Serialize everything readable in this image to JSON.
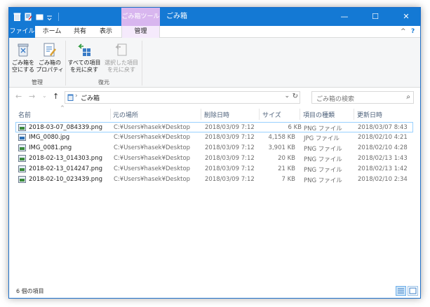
{
  "window": {
    "title": "ごみ箱",
    "context_tab_header": "ごみ箱ツール",
    "controls": {
      "minimize": "—",
      "maximize": "☐",
      "close": "✕"
    }
  },
  "ribbon_tabs": [
    {
      "label": "ファイル"
    },
    {
      "label": "ホーム"
    },
    {
      "label": "共有"
    },
    {
      "label": "表示"
    },
    {
      "label": "管理"
    }
  ],
  "ribbon_controls": {
    "collapse": "^",
    "help": "?"
  },
  "ribbon": {
    "empty_bin": "ごみ箱を\n空にする",
    "properties": "ごみ箱の\nプロパティ",
    "restore_all": "すべての項目\nを元に戻す",
    "restore_selected": "選択した項目\nを元に戻す",
    "group_manage": "管理",
    "group_restore": "復元"
  },
  "navigation": {
    "back": "←",
    "forward": "→",
    "recent": "⌄",
    "up": "↑",
    "path": "ごみ箱",
    "chevron": "›",
    "dropdown": "⌄",
    "refresh": "↻"
  },
  "search": {
    "placeholder": "ごみ箱の検索",
    "icon": "⌕"
  },
  "columns": {
    "name": "名前",
    "original_location": "元の場所",
    "date_deleted": "削除日時",
    "size": "サイズ",
    "type": "項目の種類",
    "date_modified": "更新日時"
  },
  "files": [
    {
      "name": "2018-03-07_084339.png",
      "location": "C:¥Users¥hasek¥Desktop",
      "deleted": "2018/03/09 7:12",
      "size": "6 KB",
      "type": "PNG ファイル",
      "modified": "2018/03/07 8:43",
      "kind": "png"
    },
    {
      "name": "IMG_0080.jpg",
      "location": "C:¥Users¥hasek¥Desktop",
      "deleted": "2018/03/09 7:12",
      "size": "4,158 KB",
      "type": "JPG ファイル",
      "modified": "2018/02/10 4:21",
      "kind": "jpg"
    },
    {
      "name": "IMG_0081.png",
      "location": "C:¥Users¥hasek¥Desktop",
      "deleted": "2018/03/09 7:12",
      "size": "3,901 KB",
      "type": "PNG ファイル",
      "modified": "2018/02/10 4:28",
      "kind": "png"
    },
    {
      "name": "2018-02-13_014303.png",
      "location": "C:¥Users¥hasek¥Desktop",
      "deleted": "2018/03/09 7:12",
      "size": "20 KB",
      "type": "PNG ファイル",
      "modified": "2018/02/13 1:43",
      "kind": "png"
    },
    {
      "name": "2018-02-13_014247.png",
      "location": "C:¥Users¥hasek¥Desktop",
      "deleted": "2018/03/09 7:12",
      "size": "21 KB",
      "type": "PNG ファイル",
      "modified": "2018/02/13 1:42",
      "kind": "png"
    },
    {
      "name": "2018-02-10_023439.png",
      "location": "C:¥Users¥hasek¥Desktop",
      "deleted": "2018/03/09 7:12",
      "size": "7 KB",
      "type": "PNG ファイル",
      "modified": "2018/02/10 2:34",
      "kind": "png"
    }
  ],
  "status": {
    "item_count": "6 個の項目"
  },
  "colors": {
    "accent": "#1479d4",
    "context_tab": "#d8b6ef",
    "selection_border": "#99d1ff"
  }
}
